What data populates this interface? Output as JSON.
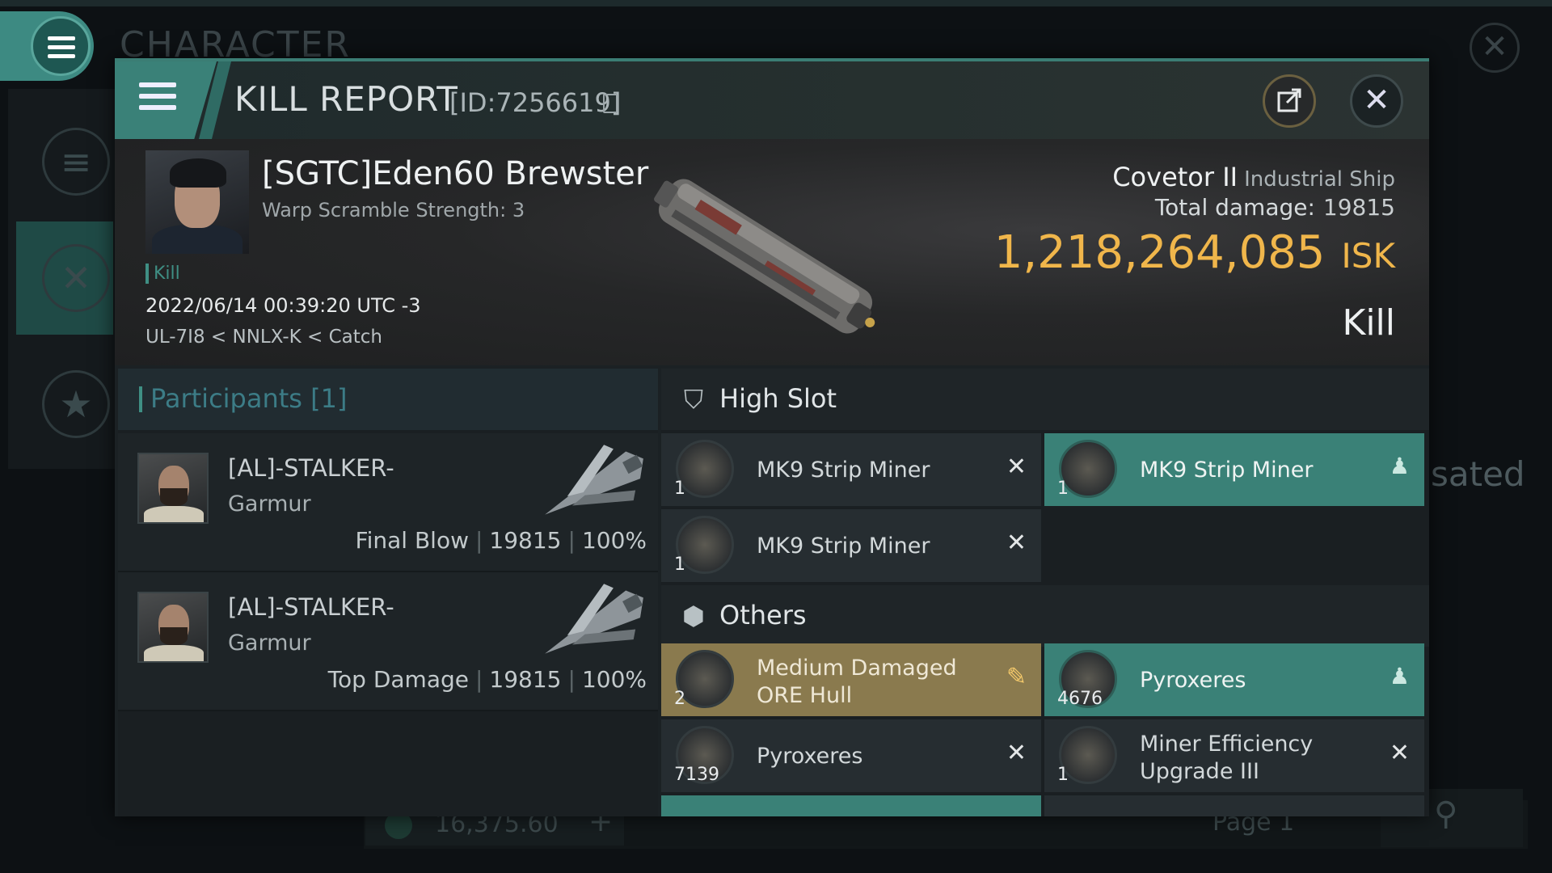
{
  "background": {
    "character_title": "CHARACTER",
    "right_text": "sated",
    "balance": "16,375.60",
    "page_label": "Page 1"
  },
  "header": {
    "title": "KILL REPORT",
    "id": "[ID:7256619]"
  },
  "victim": {
    "name": "[SGTC]Eden60 Brewster",
    "warp_scramble": "Warp Scramble Strength: 3",
    "tag": "Kill",
    "datetime": "2022/06/14 00:39:20 UTC -3",
    "location": "UL-7I8 < NNLX-K < Catch",
    "ship_name": "Covetor II",
    "ship_class": "Industrial Ship",
    "total_damage_label": "Total damage:",
    "total_damage_value": "19815",
    "isk_value": "1,218,264,085",
    "isk_unit": "ISK",
    "result": "Kill"
  },
  "participants": {
    "header": "Participants [1]",
    "rows": [
      {
        "name": "[AL]-STALKER-",
        "ship": "Garmur",
        "role": "Final Blow",
        "damage": "19815",
        "percent": "100%"
      },
      {
        "name": "[AL]-STALKER-",
        "ship": "Garmur",
        "role": "Top Damage",
        "damage": "19815",
        "percent": "100%"
      }
    ]
  },
  "fitting": {
    "high_slot_label": "High Slot",
    "others_label": "Others",
    "high_slot": [
      {
        "qty": "1",
        "name": "MK9 Strip Miner",
        "status": "destroyed"
      },
      {
        "qty": "1",
        "name": "MK9 Strip Miner",
        "status": "dropped"
      },
      {
        "qty": "1",
        "name": "MK9 Strip Miner",
        "status": "destroyed"
      }
    ],
    "others": [
      {
        "qty": "2",
        "name_line1": "Medium Damaged",
        "name_line2": "ORE Hull",
        "status": "salvage"
      },
      {
        "qty": "4676",
        "name": "Pyroxeres",
        "status": "dropped"
      },
      {
        "qty": "7139",
        "name": "Pyroxeres",
        "status": "destroyed"
      },
      {
        "qty": "1",
        "name_line1": "Miner Efficiency",
        "name_line2": "Upgrade III",
        "status": "destroyed"
      }
    ]
  },
  "colors": {
    "accent": "#3a8177",
    "isk": "#f0b64b",
    "salvage": "#8a7a4e"
  }
}
